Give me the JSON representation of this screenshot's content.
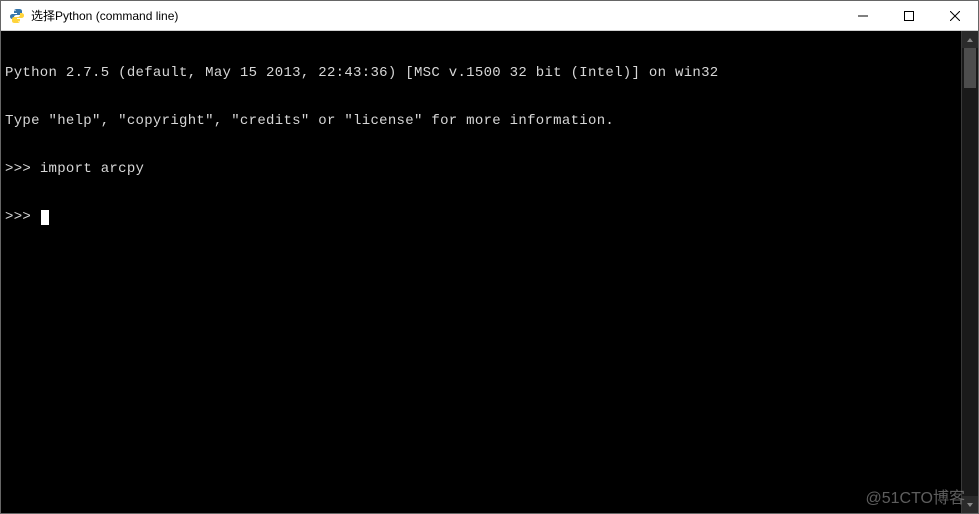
{
  "window": {
    "title": "选择Python (command line)"
  },
  "console": {
    "line1": "Python 2.7.5 (default, May 15 2013, 22:43:36) [MSC v.1500 32 bit (Intel)] on win32",
    "line2": "Type \"help\", \"copyright\", \"credits\" or \"license\" for more information.",
    "prompt1_prefix": ">>> ",
    "prompt1_cmd": "import arcpy",
    "prompt2_prefix": ">>> "
  },
  "watermark": "@51CTO博客"
}
